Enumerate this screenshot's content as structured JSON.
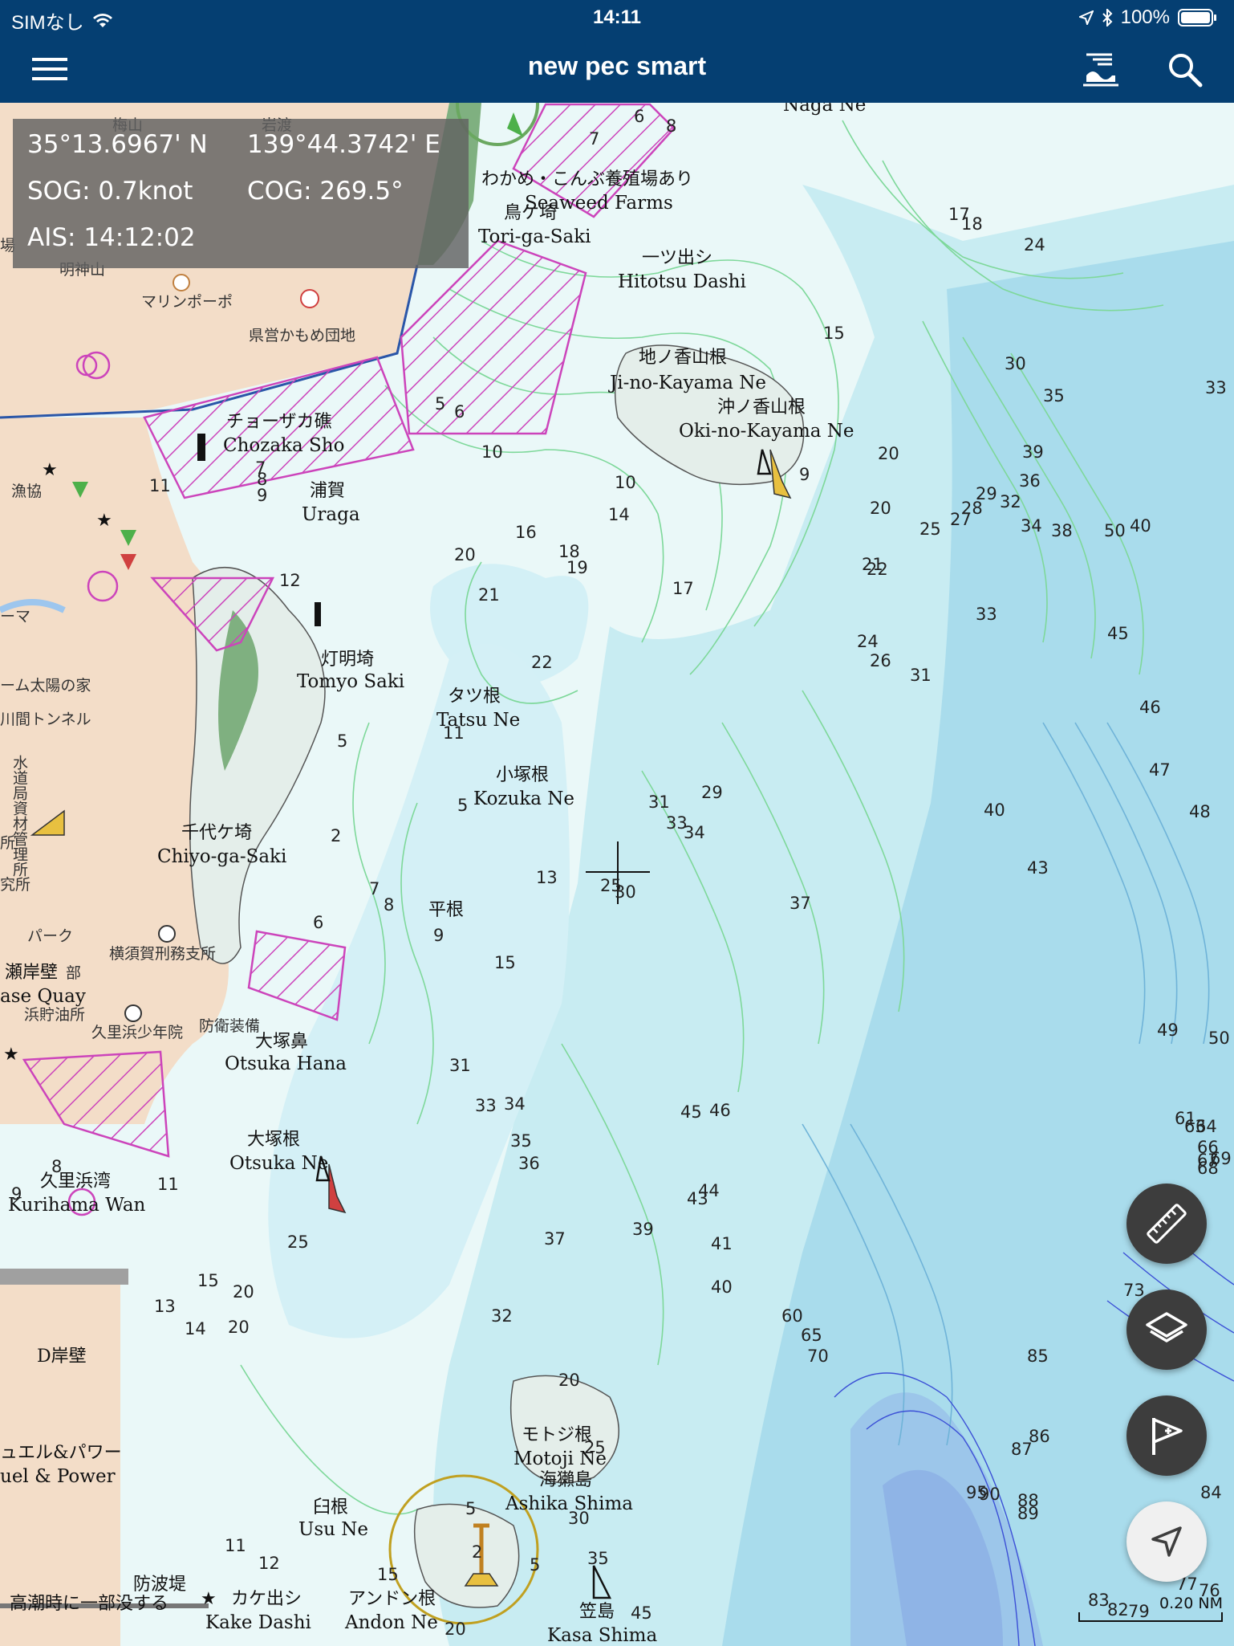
{
  "status_bar": {
    "carrier": "SIMなし",
    "time": "14:11",
    "battery": "100%"
  },
  "nav": {
    "title": "new pec smart",
    "menu_icon": "hamburger-icon",
    "tide_icon": "tide-icon",
    "search_icon": "search-icon"
  },
  "info_panel": {
    "latitude": "35°13.6967' N",
    "longitude": "139°44.3742' E",
    "sog": "SOG: 0.7knot",
    "cog": "COG: 269.5°",
    "ais": "AIS: 14:12:02"
  },
  "places": {
    "naga_ne": "Naga Ne",
    "seaweed_jp": "わかめ・こんぶ養殖場あり",
    "seaweed_en": "Seaweed Farms",
    "torigasaki_jp": "鳥ケ埼",
    "torigasaki_en": "Tori-ga-Saki",
    "hitotsu_jp": "一ツ出シ",
    "hitotsu_en": "Hitotsu Dashi",
    "jinokayama_jp": "地ノ香山根",
    "jinokayama_en": "Ji-no-Kayama Ne",
    "okinokayama_jp": "沖ノ香山根",
    "okinokayama_en": "Oki-no-Kayama Ne",
    "chozaka_jp": "チョーザカ礁",
    "chozaka_en": "Chozaka Sho",
    "uraga_jp": "浦賀",
    "uraga_en": "Uraga",
    "tomyo_jp": "灯明埼",
    "tomyo_en": "Tomyo Saki",
    "tatsu_jp": "タツ根",
    "tatsu_en": "Tatsu Ne",
    "kozuka_jp": "小塚根",
    "kozuka_en": "Kozuka Ne",
    "chiyo_jp": "千代ケ埼",
    "chiyo_en": "Chiyo-ga-Saki",
    "hirane_jp": "平根",
    "otsukahana_jp": "大塚鼻",
    "otsukahana_en": "Otsuka Hana",
    "otsukane_jp": "大塚根",
    "otsukane_en": "Otsuka Ne",
    "kurihama_jp": "久里浜湾",
    "kurihama_en": "Kurihama Wan",
    "motoji_jp": "モトジ根",
    "motoji_en": "Motoji Ne",
    "ashika_jp": "海獺島",
    "ashika_en": "Ashika Shima",
    "usu_jp": "臼根",
    "usu_en": "Usu Ne",
    "andon_jp": "アンドン根",
    "andon_en": "Andon Ne",
    "kasa_jp": "笠島",
    "kasa_en": "Kasa Shima",
    "kake_jp": "カケ出シ",
    "kake_en": "Kake Dashi",
    "bohatei": "防波堤",
    "tide_note": "高潮時に一部没する",
    "dkabe": "D岸壁",
    "fuel_jp": "ュエル&パワー",
    "fuel_en": "uel & Power",
    "quay_jp": "瀬岸壁",
    "quay_en": "ase Quay"
  },
  "land_labels": {
    "umeyama": "梅山",
    "iwado": "岩渡",
    "myojinyama": "明神山",
    "marina": "マリンポーポ",
    "kamome": "県営かもめ団地",
    "gyokyo": "漁協",
    "taiyo": "ーム太陽の家",
    "tunnel": "川間トンネル",
    "suido": "水道局資材管理所",
    "prison": "横須賀刑務支所",
    "park": "パーク",
    "kurihama_hosp": "久里浜少年院",
    "bouei": "防衛装備",
    "oil": "浜貯油所",
    "bu": "部",
    "ko": "所",
    "kenkyu": "究所",
    "ma": "ーマ",
    "jo": "場"
  },
  "depths": [
    "6",
    "8",
    "7",
    "17",
    "18",
    "24",
    "15",
    "30",
    "35",
    "33",
    "5",
    "6",
    "10",
    "10",
    "14",
    "20",
    "20",
    "39",
    "36",
    "29",
    "28",
    "27",
    "25",
    "32",
    "34",
    "38",
    "50",
    "40",
    "7",
    "8",
    "9",
    "11",
    "16",
    "18",
    "20",
    "19",
    "21",
    "21",
    "22",
    "17",
    "12",
    "33",
    "45",
    "24",
    "26",
    "31",
    "46",
    "22",
    "47",
    "48",
    "11",
    "5",
    "31",
    "29",
    "33",
    "34",
    "40",
    "43",
    "5",
    "2",
    "13",
    "25",
    "30",
    "37",
    "7",
    "8",
    "6",
    "9",
    "15",
    "31",
    "33",
    "34",
    "45",
    "46",
    "49",
    "50",
    "35",
    "36",
    "61",
    "63",
    "64",
    "66",
    "67",
    "68",
    "69",
    "43",
    "44",
    "8",
    "9",
    "11",
    "39",
    "37",
    "41",
    "40",
    "25",
    "15",
    "20",
    "13",
    "14",
    "20",
    "73",
    "32",
    "60",
    "65",
    "70",
    "85",
    "20",
    "86",
    "87",
    "25",
    "95",
    "90",
    "88",
    "89",
    "84",
    "30",
    "5",
    "2",
    "5",
    "35",
    "11",
    "12",
    "15",
    "45",
    "20",
    "77",
    "76",
    "83",
    "82",
    "79",
    "9"
  ],
  "scale": {
    "label": "0.20 NM"
  },
  "controls": {
    "ruler_icon": "ruler-icon",
    "layers_icon": "layers-icon",
    "flag_icon": "add-flag-icon",
    "locate_icon": "location-arrow-icon"
  }
}
